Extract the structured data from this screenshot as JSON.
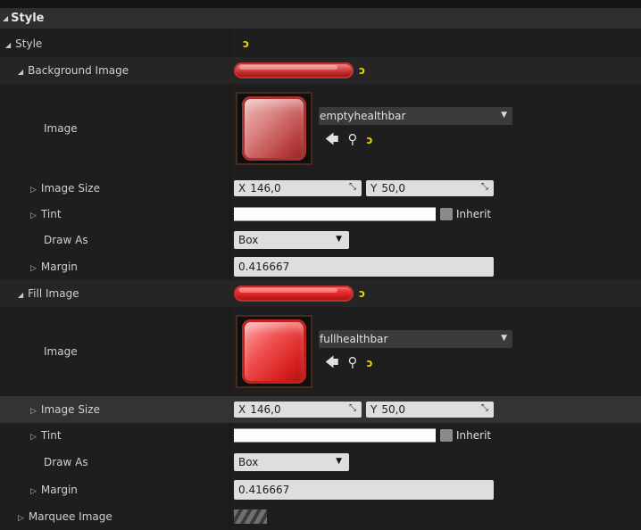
{
  "header": {
    "title": "Style"
  },
  "style_row": {
    "label": "Style"
  },
  "background_image": {
    "label": "Background Image",
    "image_label": "Image",
    "asset_name": "emptyhealthbar",
    "image_size": {
      "label": "Image Size",
      "x_axis": "X",
      "x": "146,0",
      "y_axis": "Y",
      "y": "50,0"
    },
    "tint": {
      "label": "Tint",
      "inherit_label": "Inherit"
    },
    "draw_as": {
      "label": "Draw As",
      "value": "Box"
    },
    "margin": {
      "label": "Margin",
      "value": "0.416667"
    }
  },
  "fill_image": {
    "label": "Fill Image",
    "image_label": "Image",
    "asset_name": "fullhealthbar",
    "image_size": {
      "label": "Image Size",
      "x_axis": "X",
      "x": "146,0",
      "y_axis": "Y",
      "y": "50,0"
    },
    "tint": {
      "label": "Tint",
      "inherit_label": "Inherit"
    },
    "draw_as": {
      "label": "Draw As",
      "value": "Box"
    },
    "margin": {
      "label": "Margin",
      "value": "0.416667"
    }
  },
  "marquee_image": {
    "label": "Marquee Image"
  },
  "icons": {
    "reset": "reset-to-default-icon",
    "use": "arrow-left-icon",
    "browse": "search-icon",
    "expanded": "triangle-down-icon",
    "collapsed": "triangle-right-icon"
  },
  "colors": {
    "panel_bg": "#1e1e1e",
    "header_bg": "#2f2f2f",
    "reset_yellow": "#e6d400",
    "field_bg": "#dedede"
  }
}
